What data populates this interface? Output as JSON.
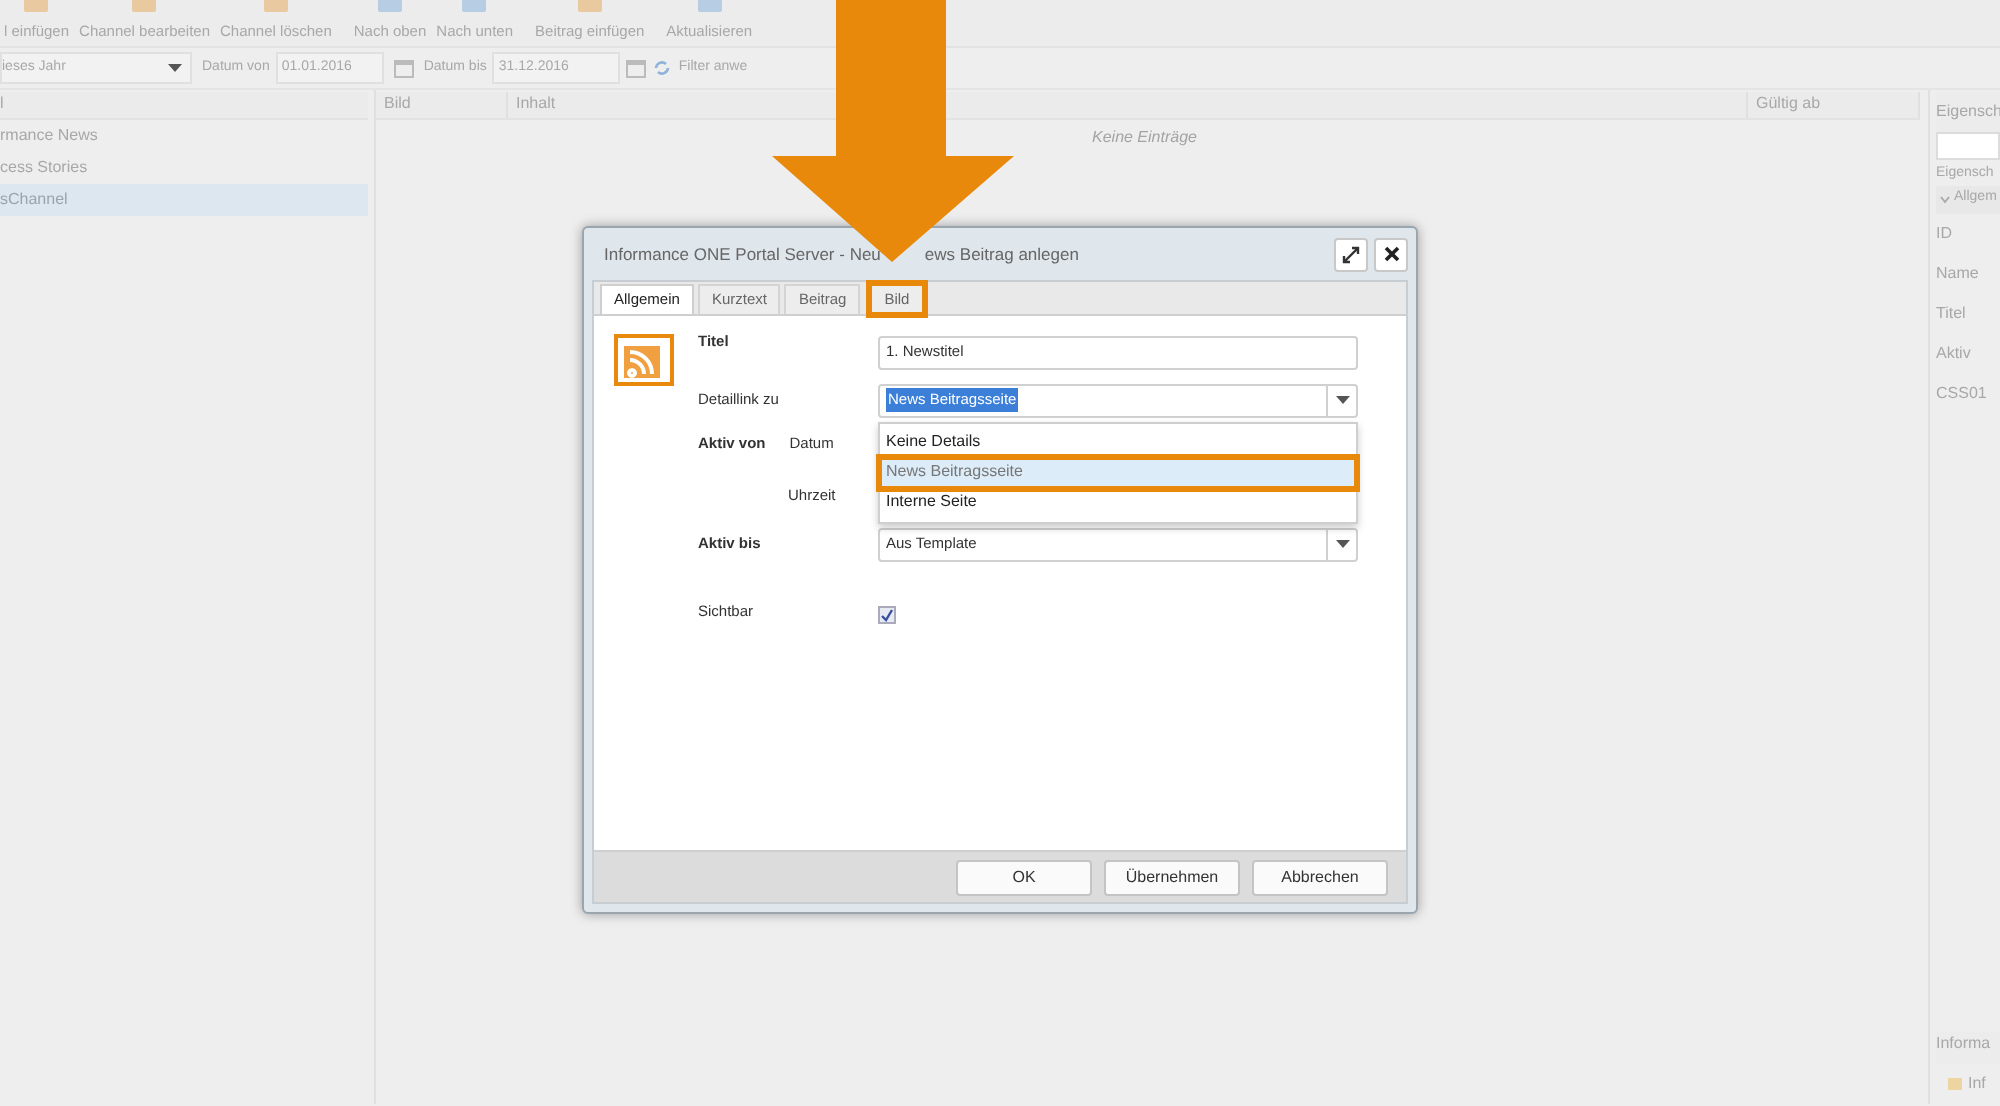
{
  "toolbar": {
    "buttons": [
      "l einfügen",
      "Channel bearbeiten",
      "Channel löschen",
      "Nach oben",
      "Nach unten",
      "Beitrag einfügen",
      "Aktualisieren"
    ]
  },
  "filter": {
    "period": "ieses Jahr",
    "from_label": "Datum von",
    "from": "01.01.2016",
    "to_label": "Datum bis",
    "to": "31.12.2016",
    "apply": "Filter anwe"
  },
  "channels": {
    "header": "l",
    "items": [
      {
        "label": "rmance News",
        "selected": false
      },
      {
        "label": "cess Stories",
        "selected": false
      },
      {
        "label": "sChannel",
        "selected": true
      }
    ]
  },
  "grid": {
    "columns": [
      "Bild",
      "Inhalt",
      "Gültig ab"
    ],
    "empty": "Keine Einträge"
  },
  "properties": {
    "title": "Eigensch",
    "subtitle": "Eigensch",
    "group": "Allgem",
    "rows": [
      "ID",
      "Name",
      "Titel",
      "Aktiv",
      "CSS01"
    ],
    "bottom_title": "Informa",
    "bottom_item": "Inf"
  },
  "dialog": {
    "title_left": "Informance ONE Portal Server - Neu",
    "title_right": "ews Beitrag anlegen",
    "tabs": [
      {
        "label": "Allgemein",
        "selected": true,
        "highlighted": false
      },
      {
        "label": "Kurztext",
        "selected": false,
        "highlighted": false
      },
      {
        "label": "Beitrag",
        "selected": false,
        "highlighted": false
      },
      {
        "label": "Bild",
        "selected": false,
        "highlighted": true
      }
    ],
    "titel_label": "Titel",
    "titel_value": "1. Newstitel",
    "detail_label": "Detaillink zu",
    "detail_value": "News Beitragsseite",
    "detail_options": [
      {
        "label": "Keine Details",
        "selected": false,
        "highlighted": false
      },
      {
        "label": "News Beitragsseite",
        "selected": true,
        "highlighted": true
      },
      {
        "label": "Interne Seite",
        "selected": false,
        "highlighted": false
      }
    ],
    "aktiv_von_label": "Aktiv von",
    "datum_label": "Datum",
    "uhrzeit_label": "Uhrzeit",
    "aktiv_bis_label": "Aktiv bis",
    "aktiv_bis_value": "Aus Template",
    "sichtbar_label": "Sichtbar",
    "sichtbar_checked": true,
    "buttons": [
      "OK",
      "Übernehmen",
      "Abbrechen"
    ]
  }
}
